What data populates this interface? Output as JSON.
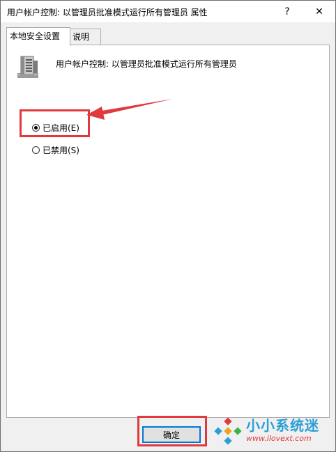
{
  "window": {
    "title": "用户帐户控制: 以管理员批准模式运行所有管理员 属性",
    "help_label": "?",
    "close_label": "✕"
  },
  "tabs": [
    {
      "label": "本地安全设置",
      "active": true
    },
    {
      "label": "说明",
      "active": false
    }
  ],
  "policy": {
    "title": "用户帐户控制: 以管理员批准模式运行所有管理员",
    "icon": "server-icon"
  },
  "options": {
    "enabled_label": "已启用(E)",
    "disabled_label": "已禁用(S)",
    "selected": "enabled"
  },
  "buttons": {
    "ok_label": "确定"
  },
  "watermark": {
    "name": "小小系统迷",
    "url": "www.ilovext.com"
  },
  "colors": {
    "highlight": "#e03a3e",
    "focus": "#0078d7",
    "watermark_blue": "#2a9fd6"
  }
}
